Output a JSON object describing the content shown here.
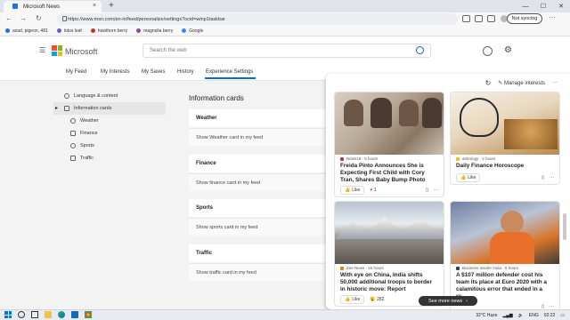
{
  "browser": {
    "tab_title": "Microsoft News",
    "tab_close": "×",
    "new_tab": "+",
    "url": "https://www.msn.com/en-in/feed/personalize/settings?ocid=winp1taskbar",
    "sync_label": "Not syncing",
    "window_controls": [
      "—",
      "☐",
      "✕"
    ],
    "bookmarks": [
      {
        "label": "azad, pigeon, 481",
        "color": "#1e73d8"
      },
      {
        "label": "lotus leaf",
        "color": "#6a5acd"
      },
      {
        "label": "hawthorn berry",
        "color": "#c0392b"
      },
      {
        "label": "magnolia berry",
        "color": "#8e44ad"
      },
      {
        "label": "Google",
        "color": "#4285f4"
      }
    ]
  },
  "header": {
    "brand": "Microsoft",
    "search_placeholder": "Search the web"
  },
  "nav": {
    "tabs": [
      "My Feed",
      "My Interests",
      "My Saves",
      "History",
      "Experience Settings"
    ],
    "active": "Experience Settings"
  },
  "sidebar": {
    "language": "Language & content",
    "info_cards": "Information cards",
    "sub_items": [
      "Weather",
      "Finance",
      "Sports",
      "Traffic"
    ]
  },
  "main": {
    "title": "Information cards",
    "cards": [
      {
        "name": "Weather",
        "desc": "Show Weather card in my feed"
      },
      {
        "name": "Finance",
        "desc": "Show finance card in my feed"
      },
      {
        "name": "Sports",
        "desc": "Show sports card in my feed"
      },
      {
        "name": "Traffic",
        "desc": "Show traffic card in my feed"
      }
    ]
  },
  "panel": {
    "manage_interests": "Manage interests",
    "more": "···",
    "news": [
      {
        "source": "News18 · 5 hours",
        "headline": "Freida Pinto Announces She is Expecting First Child with Cory Tran, Shares Baby Bump Photo",
        "like": "Like",
        "reactions": "1"
      },
      {
        "source": "astrology · 2 hours",
        "headline": "Daily Finance Horoscope",
        "like": "Like",
        "reactions": ""
      },
      {
        "source": "Zee News · 15 hours",
        "headline": "With eye on China, India shifts 50,000 additional troops to border in historic move: Report",
        "like": "Like",
        "reactions": "282"
      },
      {
        "source": "Business Insider India · 6 hours",
        "headline": "A $107 million defender cost his team its place at Euro 2020 with a calamitous error that ended in a re...",
        "like": "Like",
        "reactions": ""
      }
    ],
    "see_more": "See more news"
  },
  "taskbar": {
    "weather": "32°C  Haze",
    "lang": "ENG",
    "time": "02:22"
  }
}
